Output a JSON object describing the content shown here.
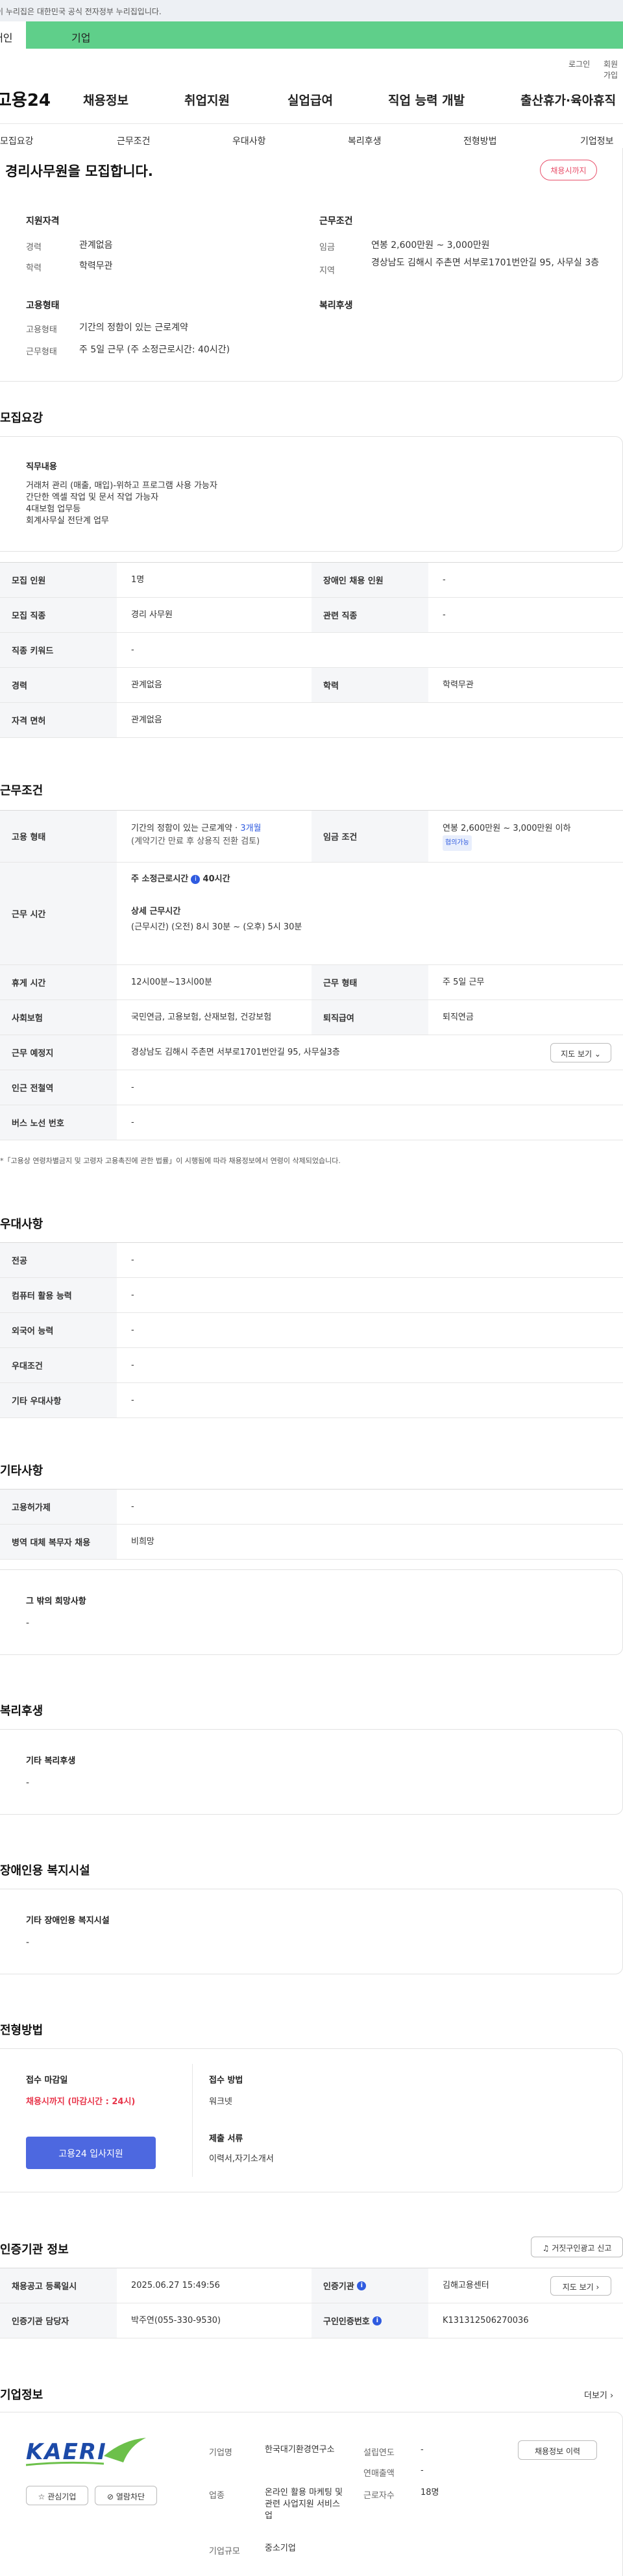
{
  "gov_banner": "이 누리집은 대한민국 공식 전자정부 누리집입니다.",
  "tabs": {
    "t1": "개인",
    "t2": "기업"
  },
  "util": {
    "login": "로그인",
    "join": "회원가입"
  },
  "gnb": {
    "logo": "고용24",
    "menu": [
      "채용정보",
      "취업지원",
      "실업급여",
      "직업 능력 개발",
      "출산휴가·육아휴직"
    ]
  },
  "snb": [
    "모집요강",
    "근무조건",
    "우대사항",
    "복리후생",
    "전형방법",
    "기업정보"
  ],
  "summary": {
    "title": "경리사무원을 모집합니다.",
    "pill": "채용시까지",
    "qual_title": "지원자격",
    "career_l": "경력",
    "career_v": "관계없음",
    "edu_l": "학력",
    "edu_v": "학력무관",
    "work_title": "근무조건",
    "pay_l": "임금",
    "pay_v": "연봉 2,600만원 ~ 3,000만원",
    "loc_l": "지역",
    "loc_v": "경상남도 김해시 주촌면 서부로1701번안길 95, 사무실 3층",
    "emp_title": "고용형태",
    "type_l": "고용형태",
    "type_v": "기간의 정함이 있는 근로계약",
    "form_l": "근무형태",
    "form_v": "주 5일 근무 (주 소정근로시간: 40시간)",
    "welfare_title": "복리후생"
  },
  "recruit": {
    "section": "모집요강",
    "duty_title": "직무내용",
    "duty": [
      "거래처 관리 (매출, 매입)-위하고 프로그램 사용 가능자",
      "간단한 엑셀 작업 및 문서 작업 가능자",
      "4대보험 업무등",
      "회계사무실 전단계 업무"
    ],
    "rows": {
      "count_l": "모집 인원",
      "count_v": "1명",
      "dis_l": "장애인 채용 인원",
      "dis_v": "-",
      "job_l": "모집 직종",
      "job_v": "경리 사무원",
      "rel_l": "관련 직종",
      "rel_v": "-",
      "kw_l": "직종 키워드",
      "kw_v": "-",
      "car_l": "경력",
      "car_v": "관계없음",
      "edu_l": "학력",
      "edu_v": "학력무관",
      "lic_l": "자격 면허",
      "lic_v": "관계없음"
    }
  },
  "work": {
    "section": "근무조건",
    "type_l": "고용 형태",
    "type_v1": "기간의 정함이 있는 근로계약 · ",
    "type_period": "3개월",
    "type_v2": "(계약기간 만료 후 상용직 전환 검토)",
    "wage_l": "임금 조건",
    "wage_v": "연봉 2,600만원 ~ 3,000만원 이하",
    "wage_badge": "협의가능",
    "time_l": "근무 시간",
    "time_v1": "주 소정근로시간",
    "time_v1b": "40시간",
    "time_v2": "상세 근무시간",
    "time_v3": "(근무시간) (오전) 8시 30분 ~ (오후) 5시 30분",
    "rest_l": "휴게 시간",
    "rest_v": "12시00분~13시00분",
    "wtype_l": "근무 형태",
    "wtype_v": "주 5일 근무",
    "ins_l": "사회보험",
    "ins_v": "국민연금, 고용보험, 산재보험, 건강보험",
    "ret_l": "퇴직급여",
    "ret_v": "퇴직연금",
    "place_l": "근무 예정지",
    "place_v": "경상남도 김해시 주촌면 서부로1701번안길 95, 사무실3층",
    "map_btn": "지도 보기",
    "sub_l": "인근 전철역",
    "sub_v": "-",
    "bus_l": "버스 노선 번호",
    "bus_v": "-",
    "note": "*「고용상 연령차별금지 및 고령자 고용촉진에 관한 법률」이 시행됨에 따라 채용정보에서 연령이 삭제되었습니다."
  },
  "pref": {
    "section": "우대사항",
    "rows": [
      [
        "전공",
        "-"
      ],
      [
        "컴퓨터 활용 능력",
        "-"
      ],
      [
        "외국어 능력",
        "-"
      ],
      [
        "우대조건",
        "-"
      ],
      [
        "기타 우대사항",
        "-"
      ]
    ]
  },
  "etc": {
    "section": "기타사항",
    "rows": [
      [
        "고용허가제",
        "-"
      ],
      [
        "병역 대체 복무자 채용",
        "비희망"
      ]
    ],
    "wish_title": "그 밖의 희망사항",
    "wish_v": "-"
  },
  "welfare": {
    "section": "복리후생",
    "title": "기타 복리후생",
    "v": "-"
  },
  "disabled": {
    "section": "장애인용 복지시설",
    "title": "기타 장애인용 복지시설",
    "v": "-"
  },
  "process": {
    "section": "전형방법",
    "deadline_l": "접수 마감일",
    "deadline_v": "채용시까지 (마감시간 : 24시)",
    "apply_btn": "고용24 입사지원",
    "method_l": "접수 방법",
    "method_v": "워크넷",
    "docs_l": "제출 서류",
    "docs_v": "이력서,자기소개서"
  },
  "cert": {
    "section": "인증기관 정보",
    "report_btn": "거짓구인광고 신고",
    "reg_l": "채용공고 등록일시",
    "reg_v": "2025.06.27 15:49:56",
    "org_l": "인증기관",
    "org_v": "김해고용센터",
    "map_btn": "지도 보기",
    "mgr_l": "인증기관 담당자",
    "mgr_v": "박주연(055-330-9530)",
    "num_l": "구인인증번호",
    "num_v": "K131312506270036"
  },
  "company": {
    "section": "기업정보",
    "more": "더보기",
    "logo_text": "KAERI",
    "fav_btn": "관심기업",
    "block_btn": "열람차단",
    "name_l": "기업명",
    "name_v": "한국대기환경연구소",
    "ind_l": "업종",
    "ind_v": "온라인 활용 마케팅 및 관련 사업지원 서비스업",
    "size_l": "기업규모",
    "size_v": "중소기업",
    "year_l": "설립연도",
    "year_v": "-",
    "sales_l": "연매출액",
    "sales_v": "-",
    "emp_l": "근로자수",
    "emp_v": "18명",
    "hist_btn": "채용정보 이력"
  },
  "colors": {
    "accent": "#5fcf8a",
    "brand_blue": "#4d68e0",
    "pill_red": "#e84f6a"
  }
}
